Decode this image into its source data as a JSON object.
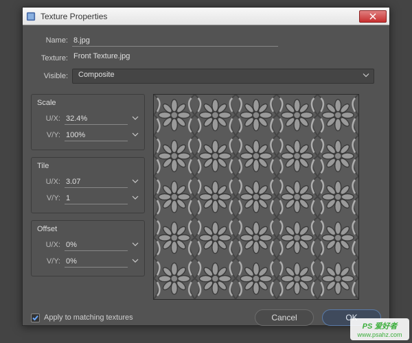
{
  "dialog": {
    "title": "Texture Properties"
  },
  "form": {
    "name_label": "Name:",
    "name_value": "8.jpg",
    "texture_label": "Texture:",
    "texture_value": "Front Texture.jpg",
    "visible_label": "Visible:",
    "visible_value": "Composite"
  },
  "scale": {
    "title": "Scale",
    "ux_label": "U/X:",
    "ux_value": "32.4%",
    "vy_label": "V/Y:",
    "vy_value": "100%"
  },
  "tile": {
    "title": "Tile",
    "ux_label": "U/X:",
    "ux_value": "3.07",
    "vy_label": "V/Y:",
    "vy_value": "1"
  },
  "offset": {
    "title": "Offset",
    "ux_label": "U/X:",
    "ux_value": "0%",
    "vy_label": "V/Y:",
    "vy_value": "0%"
  },
  "apply_label": "Apply to matching textures",
  "buttons": {
    "cancel": "Cancel",
    "ok": "OK"
  },
  "watermark": {
    "line1": "PS 爱好者",
    "line2": "www.psahz.com"
  }
}
